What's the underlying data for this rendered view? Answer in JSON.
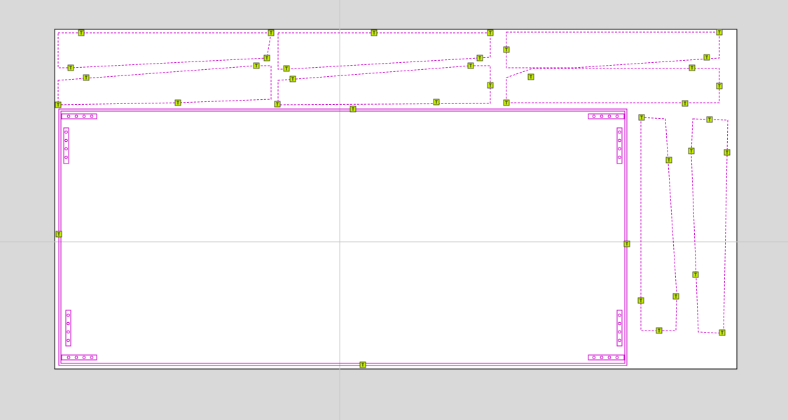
{
  "colors": {
    "background": "#d9d9d9",
    "sheet": "#ffffff",
    "sheet_border": "#000000",
    "guide": "#c8c8c8",
    "outline": "#cc00cc",
    "marker_fill": "#c6f000",
    "marker_border": "#333333"
  },
  "marker": {
    "label": "T",
    "icon": "text-tool-marker-icon"
  }
}
